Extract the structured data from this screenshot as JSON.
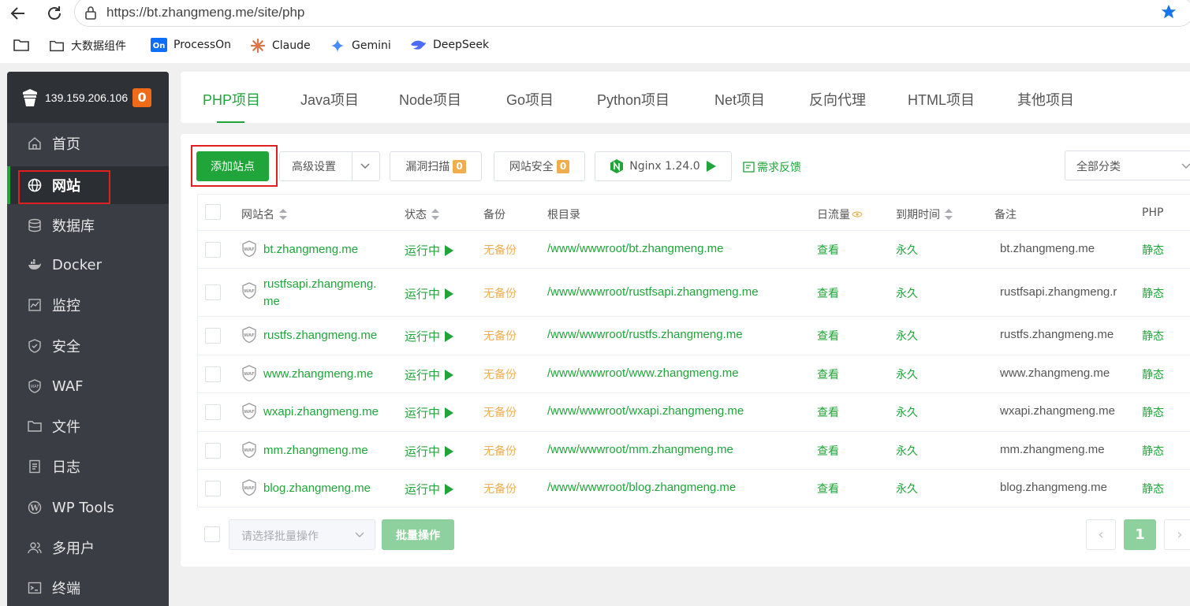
{
  "browser": {
    "url": "https://bt.zhangmeng.me/site/php"
  },
  "bookmarks": [
    {
      "label": "",
      "icon": "folder-icon"
    },
    {
      "label": "大数据组件",
      "icon": "folder-icon"
    },
    {
      "label": "ProcessOn",
      "icon": "processon-icon"
    },
    {
      "label": "Claude",
      "icon": "claude-icon"
    },
    {
      "label": "Gemini",
      "icon": "gemini-icon"
    },
    {
      "label": "DeepSeek",
      "icon": "deepseek-icon"
    }
  ],
  "server": {
    "ip": "139.159.206.106",
    "badge": "0"
  },
  "sidebar": {
    "items": [
      {
        "label": "首页",
        "icon": "home-icon"
      },
      {
        "label": "网站",
        "icon": "globe-icon"
      },
      {
        "label": "数据库",
        "icon": "database-icon"
      },
      {
        "label": "Docker",
        "icon": "docker-icon"
      },
      {
        "label": "监控",
        "icon": "monitor-icon"
      },
      {
        "label": "安全",
        "icon": "shield-icon"
      },
      {
        "label": "WAF",
        "icon": "waf-icon"
      },
      {
        "label": "文件",
        "icon": "folder-icon"
      },
      {
        "label": "日志",
        "icon": "log-icon"
      },
      {
        "label": "WP Tools",
        "icon": "wordpress-icon"
      },
      {
        "label": "多用户",
        "icon": "users-icon"
      },
      {
        "label": "终端",
        "icon": "terminal-icon"
      }
    ]
  },
  "tabs": [
    "PHP项目",
    "Java项目",
    "Node项目",
    "Go项目",
    "Python项目",
    "Net项目",
    "反向代理",
    "HTML项目",
    "其他项目"
  ],
  "toolbar": {
    "add_site": "添加站点",
    "advanced": "高级设置",
    "vuln_scan": "漏洞扫描",
    "vuln_count": "0",
    "site_security": "网站安全",
    "security_count": "0",
    "nginx": "Nginx 1.24.0",
    "feedback": "需求反馈",
    "category": "全部分类"
  },
  "table": {
    "headers": {
      "name": "网站名",
      "status": "状态",
      "backup": "备份",
      "root": "根目录",
      "traffic": "日流量",
      "expire": "到期时间",
      "note": "备注",
      "php": "PHP"
    },
    "rows": [
      {
        "name1": "bt.zhangmeng.me",
        "name2": "",
        "status": "运行中",
        "backup": "无备份",
        "root": "/www/wwwroot/bt.zhangmeng.me",
        "traffic": "查看",
        "expire": "永久",
        "note": "bt.zhangmeng.me",
        "php": "静态"
      },
      {
        "name1": "rustfsapi.zhangmeng.",
        "name2": "me",
        "status": "运行中",
        "backup": "无备份",
        "root": "/www/wwwroot/rustfsapi.zhangmeng.me",
        "traffic": "查看",
        "expire": "永久",
        "note": "rustfsapi.zhangmeng.r",
        "php": "静态"
      },
      {
        "name1": "rustfs.zhangmeng.me",
        "name2": "",
        "status": "运行中",
        "backup": "无备份",
        "root": "/www/wwwroot/rustfs.zhangmeng.me",
        "traffic": "查看",
        "expire": "永久",
        "note": "rustfs.zhangmeng.me",
        "php": "静态"
      },
      {
        "name1": "www.zhangmeng.me",
        "name2": "",
        "status": "运行中",
        "backup": "无备份",
        "root": "/www/wwwroot/www.zhangmeng.me",
        "traffic": "查看",
        "expire": "永久",
        "note": "www.zhangmeng.me",
        "php": "静态"
      },
      {
        "name1": "wxapi.zhangmeng.me",
        "name2": "",
        "status": "运行中",
        "backup": "无备份",
        "root": "/www/wwwroot/wxapi.zhangmeng.me",
        "traffic": "查看",
        "expire": "永久",
        "note": "wxapi.zhangmeng.me",
        "php": "静态"
      },
      {
        "name1": "mm.zhangmeng.me",
        "name2": "",
        "status": "运行中",
        "backup": "无备份",
        "root": "/www/wwwroot/mm.zhangmeng.me",
        "traffic": "查看",
        "expire": "永久",
        "note": "mm.zhangmeng.me",
        "php": "静态"
      },
      {
        "name1": "blog.zhangmeng.me",
        "name2": "",
        "status": "运行中",
        "backup": "无备份",
        "root": "/www/wwwroot/blog.zhangmeng.me",
        "traffic": "查看",
        "expire": "永久",
        "note": "blog.zhangmeng.me",
        "php": "静态"
      }
    ]
  },
  "footer": {
    "batch_placeholder": "请选择批量操作",
    "batch_button": "批量操作",
    "prev": "‹",
    "page": "1",
    "next": "›"
  },
  "colors": {
    "accent": "#20a53a",
    "warning": "#f0ad4e",
    "sidebar": "#3a3d43"
  }
}
